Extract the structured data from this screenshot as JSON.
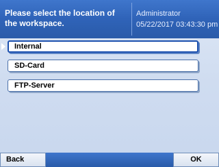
{
  "header": {
    "prompt": "Please select the location of the workspace.",
    "user": "Administrator",
    "datetime": "05/22/2017 03:43:30 pm"
  },
  "options": [
    {
      "label": "Internal",
      "selected": true
    },
    {
      "label": "SD-Card",
      "selected": false
    },
    {
      "label": "FTP-Server",
      "selected": false
    }
  ],
  "footer": {
    "back_label": "Back",
    "ok_label": "OK"
  },
  "colors": {
    "header_blue": "#2f63b8",
    "background": "#cfdcf0",
    "selection_border": "#1b4fae"
  }
}
